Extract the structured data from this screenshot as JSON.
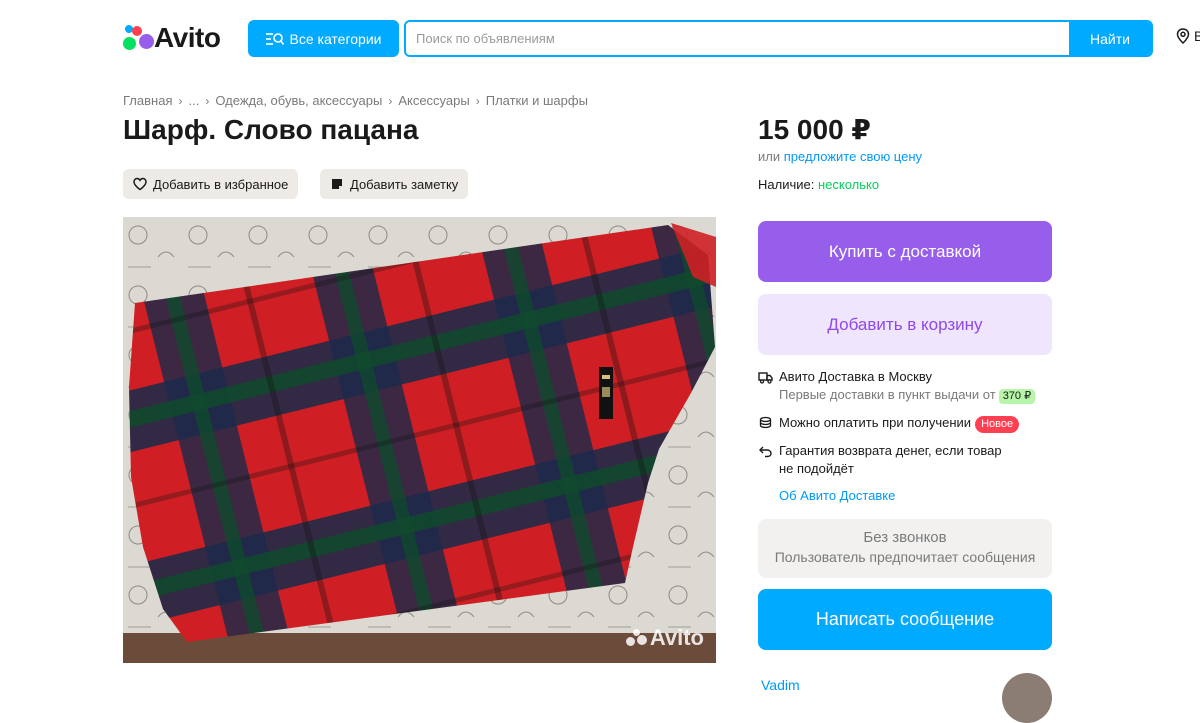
{
  "header": {
    "logo_text": "Avito",
    "categories_label": "Все категории",
    "search_placeholder": "Поиск по объявлениям",
    "search_button": "Найти",
    "location_initial": "В"
  },
  "breadcrumbs": [
    "Главная",
    "...",
    "Одежда, обувь, аксессуары",
    "Аксессуары",
    "Платки и шарфы"
  ],
  "listing": {
    "title": "Шарф. Слово пацана",
    "favorite_label": "Добавить в избранное",
    "note_label": "Добавить заметку",
    "photo_watermark": "Avito"
  },
  "sidebar": {
    "price": "15 000 ₽",
    "offer_prefix": "или",
    "offer_link": "предложите свою цену",
    "availability_label": "Наличие:",
    "availability_value": "несколько",
    "buy_button": "Купить с доставкой",
    "cart_button": "Добавить в корзину",
    "delivery_title": "Авито Доставка в Москву",
    "delivery_sub": "Первые доставки в пункт выдачи от",
    "delivery_price": "370 ₽",
    "pay_on_receipt": "Можно оплатить при получении",
    "new_badge": "Новое",
    "guarantee_line1": "Гарантия возврата денег, если товар",
    "guarantee_line2": "не подойдёт",
    "about_delivery_link": "Об Авито Доставке",
    "no_calls_title": "Без звонков",
    "no_calls_sub": "Пользователь предпочитает сообщения",
    "message_button": "Написать сообщение",
    "seller_name": "Vadim"
  },
  "colors": {
    "accent_blue": "#00aaff",
    "purple": "#965eeb",
    "purple_light": "#efe5fd",
    "green": "#02d15c",
    "red_badge": "#ff4053"
  }
}
